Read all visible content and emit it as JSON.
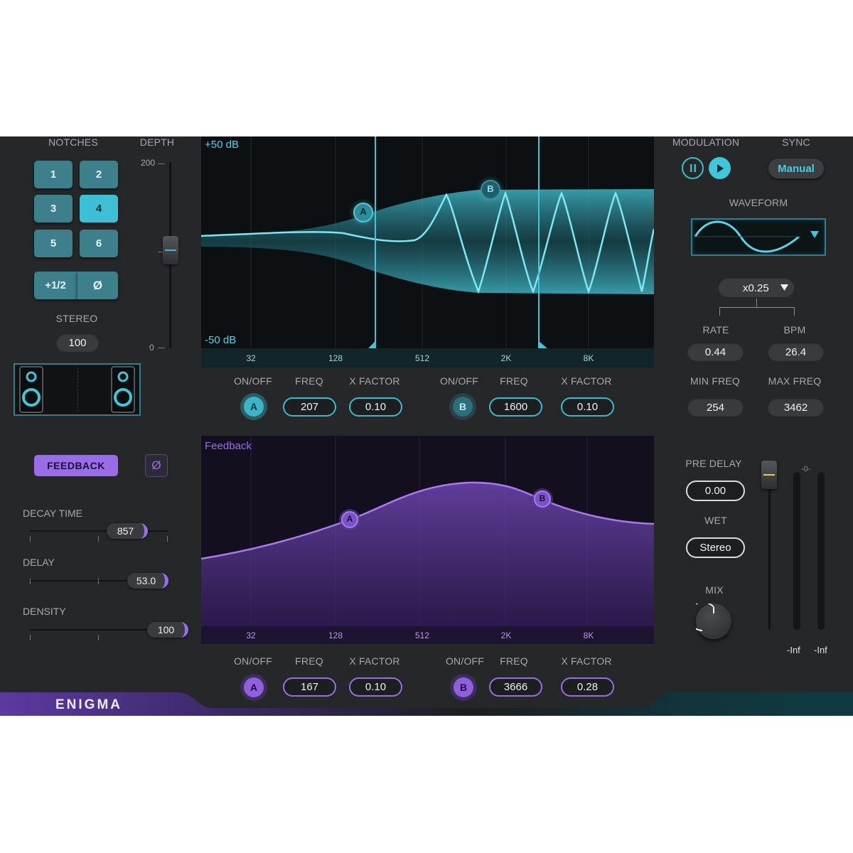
{
  "notches": {
    "title": "NOTCHES",
    "buttons": [
      "1",
      "2",
      "3",
      "4",
      "5",
      "6"
    ],
    "active": "4",
    "half_label": "+1/2",
    "phase_label": "Ø"
  },
  "depth": {
    "title": "DEPTH",
    "max_label": "200",
    "min_label": "0"
  },
  "stereo": {
    "title": "STEREO",
    "value": "100"
  },
  "feedback_section": {
    "button_label": "FEEDBACK",
    "phase_label": "Ø",
    "decay": {
      "label": "DECAY TIME",
      "value": "857",
      "level": 0.72
    },
    "delay": {
      "label": "DELAY",
      "value": "53.0",
      "level": 0.88
    },
    "density": {
      "label": "DENSITY",
      "value": "100",
      "level": 1.0
    }
  },
  "notch_graph": {
    "top_label": "+50 dB",
    "bottom_label": "-50 dB",
    "freq_labels": [
      "32",
      "128",
      "512",
      "2K",
      "8K"
    ],
    "node_a": "A",
    "node_b": "B"
  },
  "notch_controls": {
    "a": {
      "onoff_label": "ON/OFF",
      "freq_label": "FREQ",
      "xfactor_label": "X FACTOR",
      "node": "A",
      "freq": "207",
      "xfactor": "0.10"
    },
    "b": {
      "onoff_label": "ON/OFF",
      "freq_label": "FREQ",
      "xfactor_label": "X FACTOR",
      "node": "B",
      "freq": "1600",
      "xfactor": "0.10"
    }
  },
  "feedback_graph": {
    "title": "Feedback",
    "freq_labels": [
      "32",
      "128",
      "512",
      "2K",
      "8K"
    ],
    "node_a": "A",
    "node_b": "B"
  },
  "feedback_controls": {
    "a": {
      "onoff_label": "ON/OFF",
      "freq_label": "FREQ",
      "xfactor_label": "X FACTOR",
      "node": "A",
      "freq": "167",
      "xfactor": "0.10"
    },
    "b": {
      "onoff_label": "ON/OFF",
      "freq_label": "FREQ",
      "xfactor_label": "X FACTOR",
      "node": "B",
      "freq": "3666",
      "xfactor": "0.28"
    }
  },
  "modulation": {
    "title": "MODULATION",
    "sync_title": "SYNC",
    "sync_value": "Manual",
    "waveform_title": "WAVEFORM",
    "multiplier": "x0.25",
    "rate_label": "RATE",
    "rate_value": "0.44",
    "bpm_label": "BPM",
    "bpm_value": "26.4",
    "min_freq_label": "MIN FREQ",
    "min_freq_value": "254",
    "max_freq_label": "MAX FREQ",
    "max_freq_value": "3462"
  },
  "output": {
    "pre_delay_label": "PRE DELAY",
    "pre_delay_value": "0.00",
    "wet_label": "WET",
    "wet_value": "Stereo",
    "mix_label": "MIX",
    "meter_zero": "-0-",
    "meter_left": "-Inf",
    "meter_right": "-Inf"
  },
  "brand": {
    "name": "ENIGMA"
  },
  "colors": {
    "cyan": "#3fb9cc",
    "purple": "#9a6de8",
    "panel": "#262729"
  }
}
